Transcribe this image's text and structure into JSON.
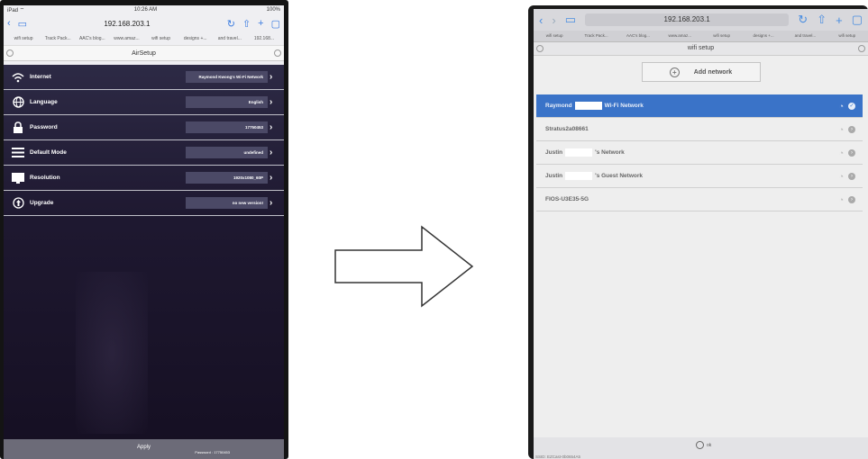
{
  "left": {
    "status": {
      "carrier": "iPad ⌔",
      "time": "10:26 AM",
      "battery": "100%"
    },
    "browser": {
      "url": "192.168.203.1"
    },
    "bookmarks": [
      "wifi setup",
      "Track Pack...",
      "AAC's blog...",
      "www.amaz...",
      "wifi setup",
      "designs +...",
      "and travel...",
      "192.168..."
    ],
    "page_title": "AirSetup",
    "rows": [
      {
        "label": "Internet",
        "value": "Raymond Kwong's Wi-Fi Network",
        "icon": "wifi-icon"
      },
      {
        "label": "Language",
        "value": "English",
        "icon": "globe-icon"
      },
      {
        "label": "Password",
        "value": "17750453",
        "icon": "lock-icon"
      },
      {
        "label": "Default Mode",
        "value": "undefined",
        "icon": "list-icon"
      },
      {
        "label": "Resolution",
        "value": "1920x1080_60P",
        "icon": "display-icon"
      },
      {
        "label": "Upgrade",
        "value": "no new version!",
        "icon": "upgrade-icon"
      }
    ],
    "apply_label": "Apply",
    "apply_sub": "Password : 17750453"
  },
  "right": {
    "browser": {
      "url": "192.168.203.1"
    },
    "bookmarks": [
      "wifi setup",
      "Track Pack...",
      "AAC's blog...",
      "www.amaz...",
      "wifi setup",
      "designs +...",
      "and travel...",
      "wifi setup"
    ],
    "page_title": "wifi setup",
    "add_network": "Add network",
    "networks": [
      {
        "pre": "Raymond",
        "post": "Wi-Fi Network",
        "masked": true,
        "selected": true,
        "action": "✓"
      },
      {
        "pre": "Stratus2a08661",
        "post": "",
        "masked": false,
        "selected": false,
        "action": "›"
      },
      {
        "pre": "Justin",
        "post": "'s Network",
        "masked": true,
        "selected": false,
        "action": "›"
      },
      {
        "pre": "Justin",
        "post": "'s Guest Network",
        "masked": true,
        "selected": false,
        "action": "›"
      },
      {
        "pre": "FIOS-U3E35-5G",
        "post": "",
        "masked": false,
        "selected": false,
        "action": "›"
      }
    ],
    "ok_label": "ok",
    "footer_ssid": "SSID: EZCast-0b0654A5"
  },
  "colors": {
    "selected_row": "#3a73c8",
    "air_bg": "#1e1830",
    "value_box": "#4b4966",
    "ios_blue": "#3a7be0"
  }
}
